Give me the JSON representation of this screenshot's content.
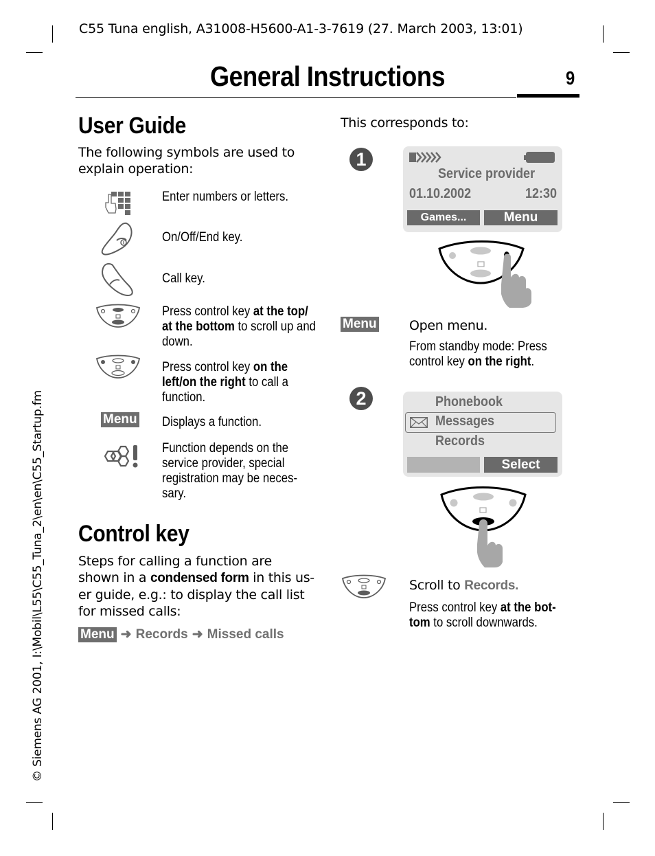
{
  "header": {
    "doc_line": "C55 Tuna english, A31008-H5600-A1-3-7619 (27. March 2003, 13:01)",
    "title": "General Instructions",
    "page_number": "9"
  },
  "side_note": "© Siemens AG 2001, I:\\Mobil\\L55\\C55_Tuna_2\\en\\en\\C55_Startup.fm",
  "user_guide": {
    "heading": "User Guide",
    "intro": "The following symbols are used to explain operation:",
    "symbols": [
      {
        "icon": "keypad-icon",
        "text": "Enter numbers or letters."
      },
      {
        "icon": "end-key-icon",
        "text": "On/Off/End key."
      },
      {
        "icon": "call-key-icon",
        "text": "Call key."
      },
      {
        "icon": "control-key-up-down-icon",
        "text_pre": "Press control key ",
        "text_bold": "at the top/ at the bottom",
        "text_post": " to scroll up and down."
      },
      {
        "icon": "control-key-left-right-icon",
        "text_pre": "Press control key ",
        "text_bold": "on the left/on the right",
        "text_post": " to call a function."
      },
      {
        "icon": "menu-softkey-icon",
        "icon_label": "Menu",
        "text": "Displays a function."
      },
      {
        "icon": "provider-dependent-icon",
        "text": "Function depends on the service provider, special registration may be neces-sary."
      }
    ]
  },
  "control_key": {
    "heading": "Control key",
    "para_pre": "Steps for calling a function are shown in a ",
    "para_bold": "condensed form",
    "para_post": " in this us-er guide, e.g.: to display the call list for missed calls:",
    "path": {
      "menu": "Menu",
      "arrow": "➜",
      "step1": "Records",
      "step2": "Missed calls"
    }
  },
  "right_column": {
    "intro": "This corresponds to:",
    "step1": {
      "badge": "1",
      "screen": {
        "provider": "Service provider",
        "date": "01.10.2002",
        "time": "12:30",
        "left_softkey": "Games...",
        "right_softkey": "Menu"
      },
      "action_tag": "Menu",
      "action_title": "Open menu.",
      "action_desc_pre": "From standby mode: Press control key ",
      "action_desc_bold": "on the right",
      "action_desc_post": "."
    },
    "step2": {
      "badge": "2",
      "screen": {
        "items": [
          "Phonebook",
          "Messages",
          "Records"
        ],
        "selected_index": 1,
        "left_softkey": "",
        "right_softkey": "Select"
      },
      "action_title_pre": "Scroll to ",
      "action_title_grey": "Records.",
      "action_desc_pre": "Press control key ",
      "action_desc_bold": "at the bot-tom",
      "action_desc_post": " to scroll downwards."
    }
  }
}
